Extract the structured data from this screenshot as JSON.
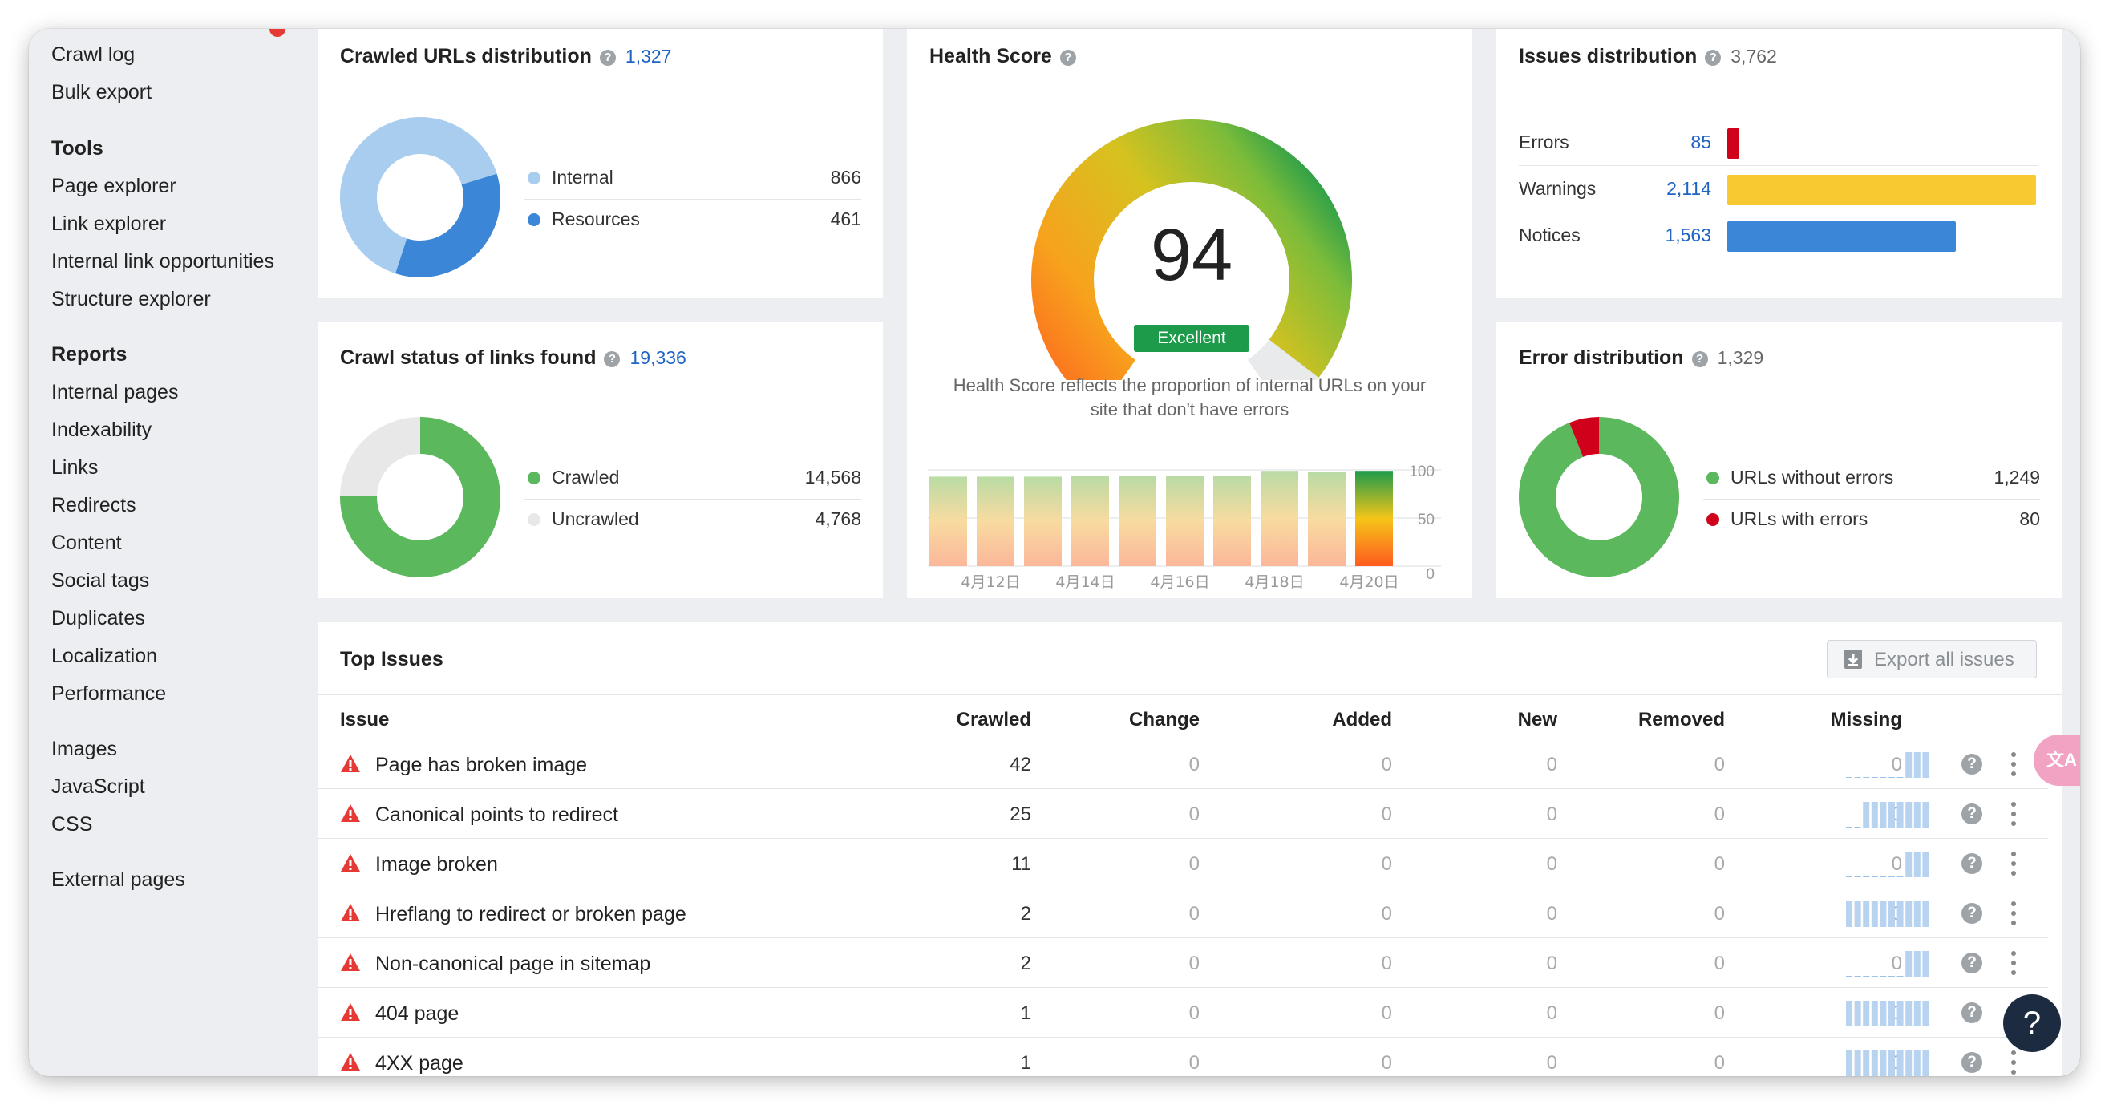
{
  "sidebar": {
    "top_items": [
      "Crawl log",
      "Bulk export"
    ],
    "tools_heading": "Tools",
    "tools": [
      "Page explorer",
      "Link explorer",
      "Internal link opportunities",
      "Structure explorer"
    ],
    "reports_heading": "Reports",
    "reports": [
      "Internal pages",
      "Indexability",
      "Links",
      "Redirects",
      "Content",
      "Social tags",
      "Duplicates",
      "Localization",
      "Performance"
    ],
    "resources": [
      "Images",
      "JavaScript",
      "CSS"
    ],
    "external": [
      "External pages"
    ]
  },
  "crawled_urls": {
    "title": "Crawled URLs distribution",
    "total": "1,327",
    "legend": [
      {
        "label": "Internal",
        "value": "866",
        "color": "#a9cdee"
      },
      {
        "label": "Resources",
        "value": "461",
        "color": "#3b86d6"
      }
    ]
  },
  "crawl_status": {
    "title": "Crawl status of links found",
    "total": "19,336",
    "legend": [
      {
        "label": "Crawled",
        "value": "14,568",
        "color": "#5cb85c"
      },
      {
        "label": "Uncrawled",
        "value": "4,768",
        "color": "#e8e8e8"
      }
    ]
  },
  "health": {
    "title": "Health Score",
    "score": "94",
    "score_fraction": 0.94,
    "rating": "Excellent",
    "description": "Health Score reflects the proportion of internal URLs on your site that don't have errors",
    "history_labels": [
      "4月12日",
      "4月14日",
      "4月16日",
      "4月18日",
      "4月20日"
    ],
    "history_axis": [
      "100",
      "50",
      "0"
    ],
    "history_values": [
      93,
      93,
      93,
      94,
      94,
      94,
      94,
      99,
      98,
      99
    ]
  },
  "issues_dist": {
    "title": "Issues distribution",
    "total": "3,762",
    "rows": [
      {
        "label": "Errors",
        "value": "85",
        "amount": 85,
        "color": "#d0021b"
      },
      {
        "label": "Warnings",
        "value": "2,114",
        "amount": 2114,
        "color": "#f9c932"
      },
      {
        "label": "Notices",
        "value": "1,563",
        "amount": 1563,
        "color": "#3b86d6"
      }
    ]
  },
  "error_dist": {
    "title": "Error distribution",
    "total": "1,329",
    "legend": [
      {
        "label": "URLs without errors",
        "value": "1,249",
        "color": "#5cb85c"
      },
      {
        "label": "URLs with errors",
        "value": "80",
        "color": "#d0021b"
      }
    ]
  },
  "top_issues": {
    "title": "Top Issues",
    "export_label": "Export all issues",
    "columns": [
      "Issue",
      "Crawled",
      "Change",
      "Added",
      "New",
      "Removed",
      "Missing"
    ],
    "rows": [
      {
        "issue": "Page has broken image",
        "crawled": "42",
        "change": "0",
        "added": "0",
        "new": "0",
        "removed": "0",
        "missing": "0",
        "trend": "recent"
      },
      {
        "issue": "Canonical points to redirect",
        "crawled": "25",
        "change": "0",
        "added": "0",
        "new": "0",
        "removed": "0",
        "missing": "0",
        "trend": "partial"
      },
      {
        "issue": "Image broken",
        "crawled": "11",
        "change": "0",
        "added": "0",
        "new": "0",
        "removed": "0",
        "missing": "0",
        "trend": "recent"
      },
      {
        "issue": "Hreflang to redirect or broken page",
        "crawled": "2",
        "change": "0",
        "added": "0",
        "new": "0",
        "removed": "0",
        "missing": "0",
        "trend": "full"
      },
      {
        "issue": "Non-canonical page in sitemap",
        "crawled": "2",
        "change": "0",
        "added": "0",
        "new": "0",
        "removed": "0",
        "missing": "0",
        "trend": "recent"
      },
      {
        "issue": "404 page",
        "crawled": "1",
        "change": "0",
        "added": "0",
        "new": "0",
        "removed": "0",
        "missing": "0",
        "trend": "full"
      },
      {
        "issue": "4XX page",
        "crawled": "1",
        "change": "0",
        "added": "0",
        "new": "0",
        "removed": "0",
        "missing": "0",
        "trend": "full"
      }
    ]
  },
  "help_bubble": "?",
  "translate_label": "文A"
}
